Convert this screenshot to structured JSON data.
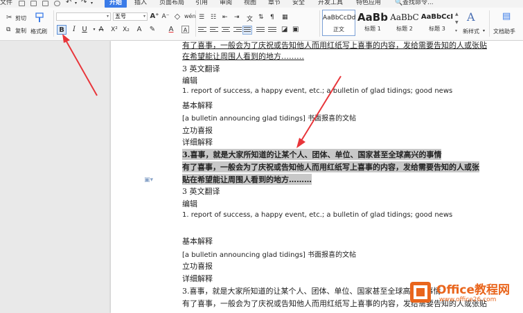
{
  "menubar": {
    "file": "文件",
    "tabs": [
      "开始",
      "插入",
      "页面布局",
      "引用",
      "审阅",
      "视图",
      "章节",
      "安全",
      "开发工具",
      "特色应用"
    ],
    "active_tab": "开始",
    "search_placeholder": "查找命令..."
  },
  "ribbon": {
    "cut": "剪切",
    "copy": "复制",
    "format_painter": "格式刷",
    "font_size": "五号",
    "bold": "B",
    "italic": "I",
    "underline": "U",
    "font_color_letter": "A",
    "styles": [
      {
        "sample": "AaBbCcDd",
        "label": "正文"
      },
      {
        "sample": "AaBb",
        "label": "标题 1"
      },
      {
        "sample": "AaBbC",
        "label": "标题 2"
      },
      {
        "sample": "AaBbCcI",
        "label": "标题 3"
      }
    ],
    "new_style": "新样式",
    "doc_assistant": "文档助手"
  },
  "document": {
    "lines": [
      {
        "text": "有了喜事，一般会为了庆祝或告知他人而用红纸写上喜事的内容，发给需要告知的人或张贴",
        "style": "ul"
      },
      {
        "text": "在希望能让周围人看到的地方………",
        "style": "ul"
      },
      {
        "text": "3 英文翻译",
        "style": ""
      },
      {
        "text": "编辑",
        "style": ""
      },
      {
        "text": "1. report of success, a happy event, etc.; a bulletin of glad tidings; good news",
        "style": "latin"
      },
      {
        "text": "基本解释",
        "style": ""
      },
      {
        "text": "[a bulletin announcing glad tidings]  书面报喜的文帖",
        "style": "latin"
      },
      {
        "text": "立功喜报",
        "style": ""
      },
      {
        "text": "详细解释",
        "style": ""
      },
      {
        "text": "3.喜事，就是大家所知道的让某个人、团体、单位、国家甚至全球高兴的事情",
        "style": "bold hl"
      },
      {
        "text": "有了喜事，一般会为了庆祝或告知他人而用红纸写上喜事的内容，发给需要告知的人或张",
        "style": "bold hl"
      },
      {
        "text": "贴在希望能让周围人看到的地方………",
        "style": "bold hl"
      },
      {
        "text": "3 英文翻译",
        "style": ""
      },
      {
        "text": "编辑",
        "style": ""
      },
      {
        "text": "1. report of success, a happy event, etc.; a bulletin of glad tidings; good news",
        "style": "latin"
      },
      {
        "text": "基本解释",
        "style": ""
      },
      {
        "text": "[a bulletin announcing glad tidings]  书面报喜的文帖",
        "style": "latin"
      },
      {
        "text": "立功喜报",
        "style": ""
      },
      {
        "text": "详细解释",
        "style": ""
      },
      {
        "text": "3.喜事，就是大家所知道的让某个人、团体、单位、国家甚至全球高兴的事情",
        "style": ""
      },
      {
        "text": "有了喜事，一般会为了庆祝或告知他人而用红纸写上喜事的内容，发给需要告知的人或张贴",
        "style": ""
      }
    ]
  },
  "watermark": {
    "title": "Office教程网",
    "url": "www.office26.com"
  },
  "colors": {
    "accent": "#3a7be8",
    "annotation_arrow": "#e8353a",
    "watermark": "#e9651c"
  }
}
